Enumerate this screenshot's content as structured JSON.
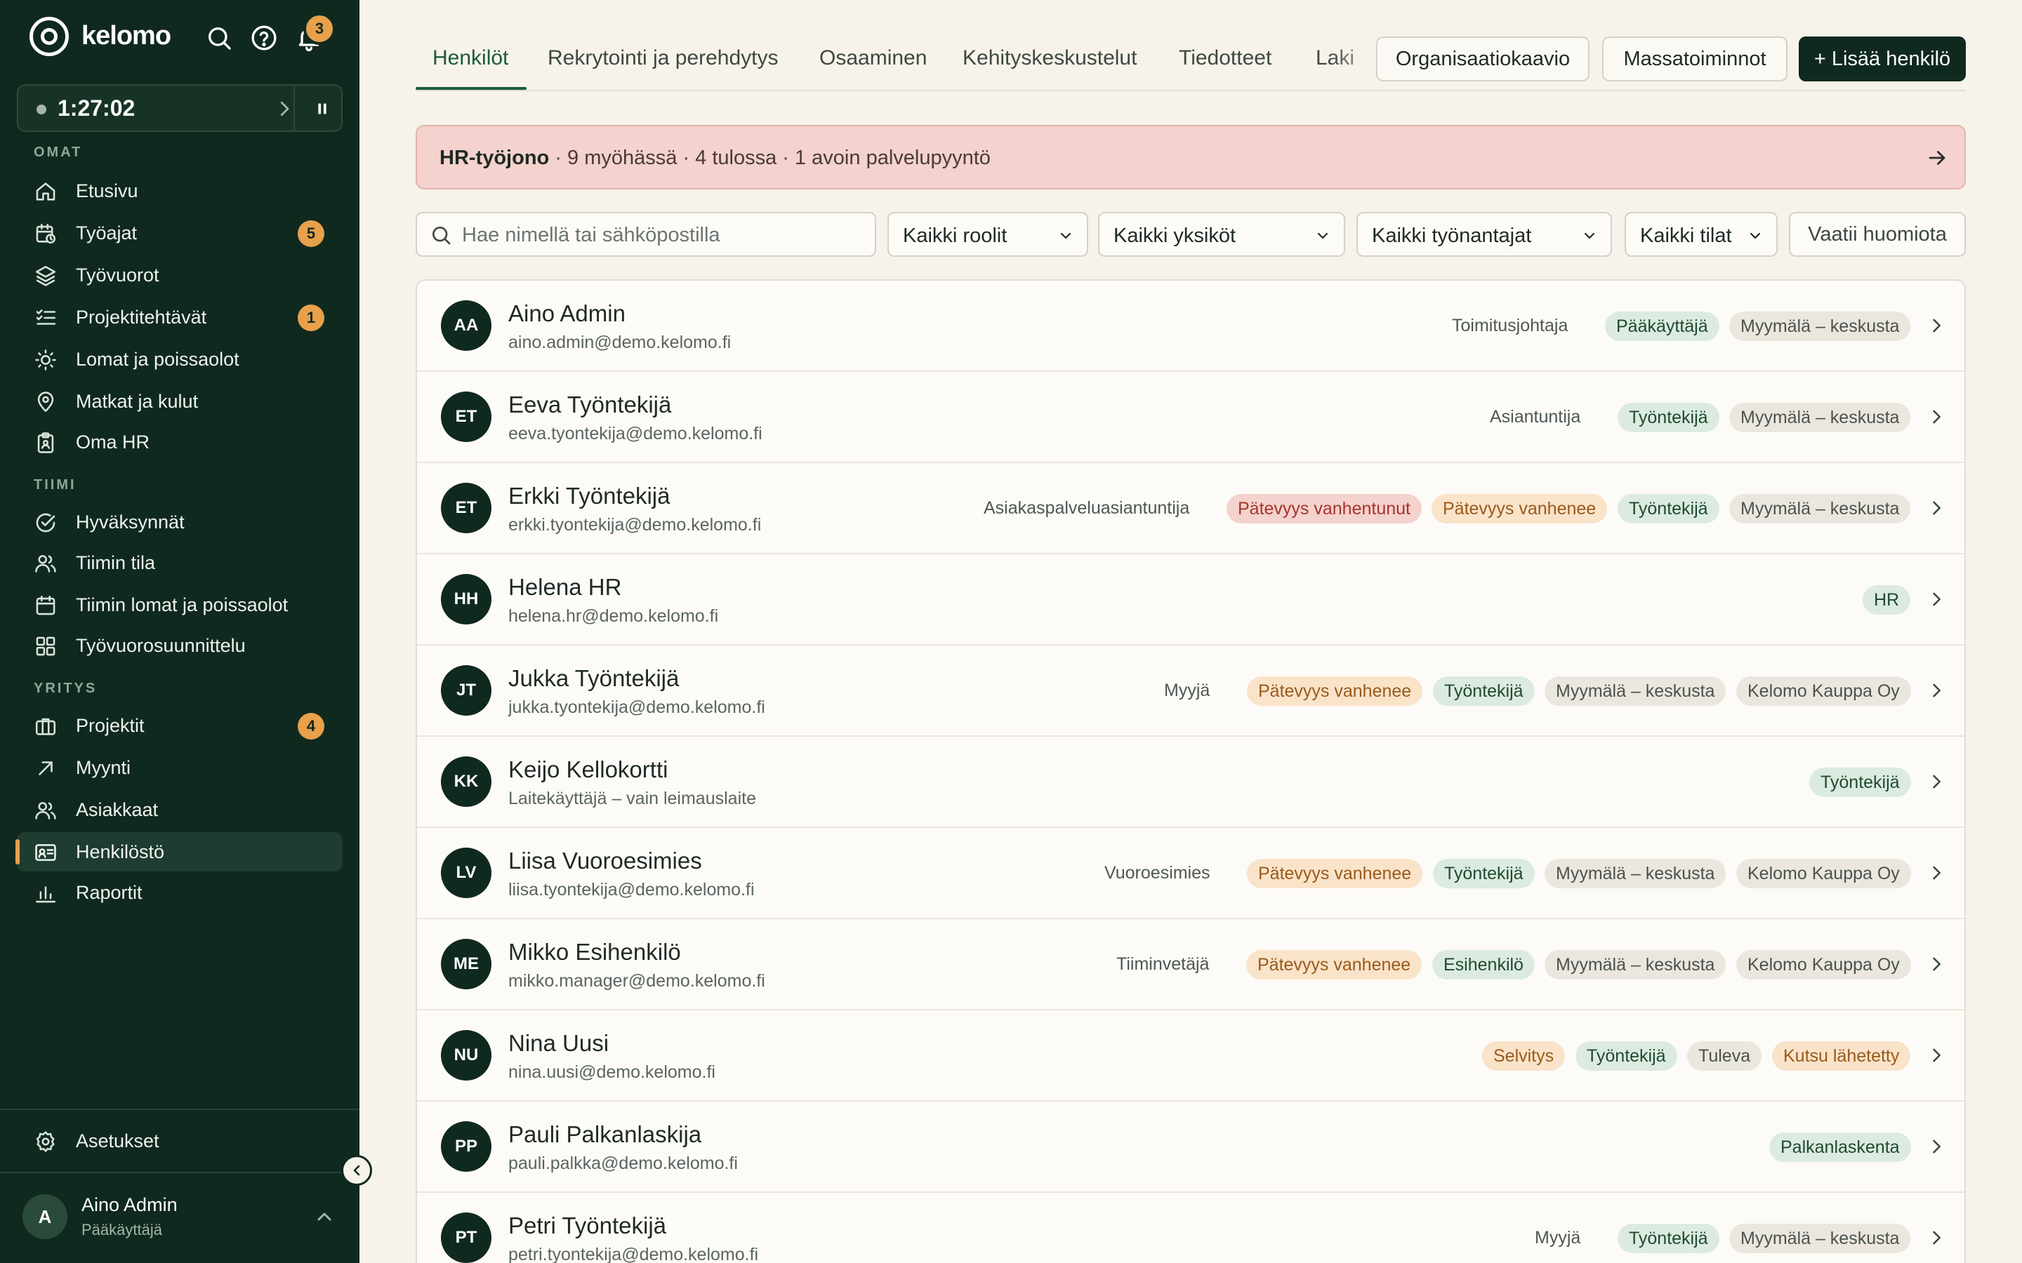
{
  "sidebar": {
    "brand": "kelomo",
    "notification_count": "3",
    "timer": "1:27:02",
    "sections": {
      "omat": "OMAT",
      "tiimi": "TIIMI",
      "yritys": "YRITYS"
    },
    "items": [
      {
        "label": "Etusivu",
        "icon": "home-icon"
      },
      {
        "label": "Työajat",
        "icon": "calendar-clock-icon",
        "badge": "5"
      },
      {
        "label": "Työvuorot",
        "icon": "layers-icon"
      },
      {
        "label": "Projektitehtävät",
        "icon": "checklist-icon",
        "badge": "1"
      },
      {
        "label": "Lomat ja poissaolot",
        "icon": "sun-icon"
      },
      {
        "label": "Matkat ja kulut",
        "icon": "map-pin-icon"
      },
      {
        "label": "Oma HR",
        "icon": "clipboard-icon"
      },
      {
        "label": "Hyväksynnät",
        "icon": "check-circle-icon"
      },
      {
        "label": "Tiimin tila",
        "icon": "users-icon"
      },
      {
        "label": "Tiimin lomat ja poissaolot",
        "icon": "calendar-icon"
      },
      {
        "label": "Työvuorosuunnittelu",
        "icon": "grid-icon"
      },
      {
        "label": "Projektit",
        "icon": "briefcase-icon",
        "badge": "4"
      },
      {
        "label": "Myynti",
        "icon": "arrow-up-right-icon"
      },
      {
        "label": "Asiakkaat",
        "icon": "users-icon"
      },
      {
        "label": "Henkilöstö",
        "icon": "id-card-icon",
        "active": true
      },
      {
        "label": "Raportit",
        "icon": "bar-chart-icon"
      }
    ],
    "settings_label": "Asetukset",
    "user": {
      "initial": "A",
      "name": "Aino Admin",
      "role": "Pääkäyttäjä"
    }
  },
  "tabs": [
    {
      "label": "Henkilöt",
      "active": true
    },
    {
      "label": "Rekrytointi ja perehdytys"
    },
    {
      "label": "Osaaminen"
    },
    {
      "label": "Kehityskeskustelut"
    },
    {
      "label": "Tiedotteet"
    },
    {
      "label": "Laki"
    }
  ],
  "actions": {
    "org_chart": "Organisaatiokaavio",
    "bulk": "Massatoiminnot",
    "add_person": "+ Lisää henkilö"
  },
  "banner": {
    "title": "HR-työjono",
    "text": " · 9 myöhässä · 4 tulossa · 1 avoin palvelupyyntö"
  },
  "filters": {
    "search_placeholder": "Hae nimellä tai sähköpostilla",
    "roles": "Kaikki roolit",
    "units": "Kaikki yksiköt",
    "employers": "Kaikki työnantajat",
    "states": "Kaikki tilat",
    "attention": "Vaatii huomiota"
  },
  "people": [
    {
      "initials": "AA",
      "name": "Aino Admin",
      "email": "aino.admin@demo.kelomo.fi",
      "title": "Toimitusjohtaja",
      "chips": [
        {
          "text": "Pääkäyttäjä",
          "kind": "role"
        },
        {
          "text": "Myymälä – keskusta",
          "kind": "unit"
        }
      ]
    },
    {
      "initials": "ET",
      "name": "Eeva Työntekijä",
      "email": "eeva.tyontekija@demo.kelomo.fi",
      "title": "Asiantuntija",
      "chips": [
        {
          "text": "Työntekijä",
          "kind": "role"
        },
        {
          "text": "Myymälä – keskusta",
          "kind": "unit"
        }
      ]
    },
    {
      "initials": "ET",
      "name": "Erkki Työntekijä",
      "email": "erkki.tyontekija@demo.kelomo.fi",
      "title": "Asiakaspalveluasiantuntija",
      "chips": [
        {
          "text": "Pätevyys vanhentunut",
          "kind": "bad"
        },
        {
          "text": "Pätevyys vanhenee",
          "kind": "warn"
        },
        {
          "text": "Työntekijä",
          "kind": "role"
        },
        {
          "text": "Myymälä – keskusta",
          "kind": "unit"
        }
      ]
    },
    {
      "initials": "HH",
      "name": "Helena HR",
      "email": "helena.hr@demo.kelomo.fi",
      "title": "",
      "chips": [
        {
          "text": "HR",
          "kind": "role"
        }
      ]
    },
    {
      "initials": "JT",
      "name": "Jukka Työntekijä",
      "email": "jukka.tyontekija@demo.kelomo.fi",
      "title": "Myyjä",
      "chips": [
        {
          "text": "Pätevyys vanhenee",
          "kind": "warn"
        },
        {
          "text": "Työntekijä",
          "kind": "role"
        },
        {
          "text": "Myymälä – keskusta",
          "kind": "unit"
        },
        {
          "text": "Kelomo Kauppa Oy",
          "kind": "unit"
        }
      ]
    },
    {
      "initials": "KK",
      "name": "Keijo Kellokortti",
      "email": "Laitekäyttäjä – vain leimauslaite",
      "title": "",
      "chips": [
        {
          "text": "Työntekijä",
          "kind": "role"
        }
      ]
    },
    {
      "initials": "LV",
      "name": "Liisa Vuoroesimies",
      "email": "liisa.tyontekija@demo.kelomo.fi",
      "title": "Vuoroesimies",
      "chips": [
        {
          "text": "Pätevyys vanhenee",
          "kind": "warn"
        },
        {
          "text": "Työntekijä",
          "kind": "role"
        },
        {
          "text": "Myymälä – keskusta",
          "kind": "unit"
        },
        {
          "text": "Kelomo Kauppa Oy",
          "kind": "unit"
        }
      ]
    },
    {
      "initials": "ME",
      "name": "Mikko Esihenkilö",
      "email": "mikko.manager@demo.kelomo.fi",
      "title": "Tiiminvetäjä",
      "chips": [
        {
          "text": "Pätevyys vanhenee",
          "kind": "warn"
        },
        {
          "text": "Esihenkilö",
          "kind": "role"
        },
        {
          "text": "Myymälä – keskusta",
          "kind": "unit"
        },
        {
          "text": "Kelomo Kauppa Oy",
          "kind": "unit"
        }
      ]
    },
    {
      "initials": "NU",
      "name": "Nina Uusi",
      "email": "nina.uusi@demo.kelomo.fi",
      "title": "",
      "chips": [
        {
          "text": "Selvitys",
          "kind": "warn"
        },
        {
          "text": "Työntekijä",
          "kind": "role"
        },
        {
          "text": "Tuleva",
          "kind": "unit"
        },
        {
          "text": "Kutsu lähetetty",
          "kind": "warn"
        }
      ]
    },
    {
      "initials": "PP",
      "name": "Pauli Palkanlaskija",
      "email": "pauli.palkka@demo.kelomo.fi",
      "title": "",
      "chips": [
        {
          "text": "Palkanlaskenta",
          "kind": "role"
        }
      ]
    },
    {
      "initials": "PT",
      "name": "Petri Työntekijä",
      "email": "petri.tyontekija@demo.kelomo.fi",
      "title": "Myyjä",
      "chips": [
        {
          "text": "Työntekijä",
          "kind": "role"
        },
        {
          "text": "Myymälä – keskusta",
          "kind": "unit"
        }
      ]
    }
  ]
}
